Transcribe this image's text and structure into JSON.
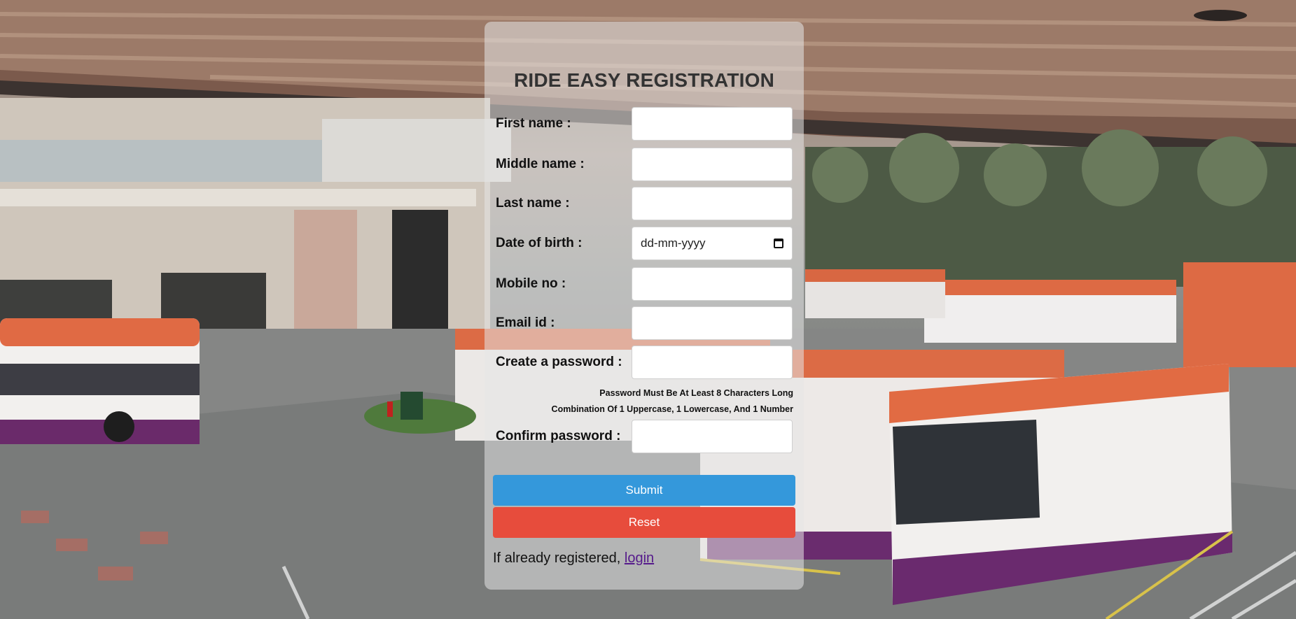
{
  "form": {
    "title": "RIDE EASY REGISTRATION",
    "fields": {
      "first_name": {
        "label": "First name :",
        "value": ""
      },
      "middle_name": {
        "label": "Middle name :",
        "value": ""
      },
      "last_name": {
        "label": "Last name :",
        "value": ""
      },
      "dob": {
        "label": "Date of birth :",
        "placeholder": "dd-mm-yyyy"
      },
      "mobile": {
        "label": "Mobile no :",
        "value": ""
      },
      "email": {
        "label": "Email id :",
        "value": ""
      },
      "password": {
        "label": "Create a password :",
        "value": ""
      },
      "confirm_password": {
        "label": "Confirm password :",
        "value": ""
      }
    },
    "password_hint_line1": "Password Must Be At Least 8 Characters Long",
    "password_hint_line2": "Combination Of 1 Uppercase, 1 Lowercase, And 1 Number",
    "submit_label": "Submit",
    "reset_label": "Reset",
    "footer_text": "If already registered, ",
    "login_link": "login"
  },
  "colors": {
    "submit": "#3498db",
    "reset": "#e74c3c",
    "link": "#551a8b",
    "title": "#333333"
  },
  "icons": {
    "calendar": "calendar-icon"
  }
}
